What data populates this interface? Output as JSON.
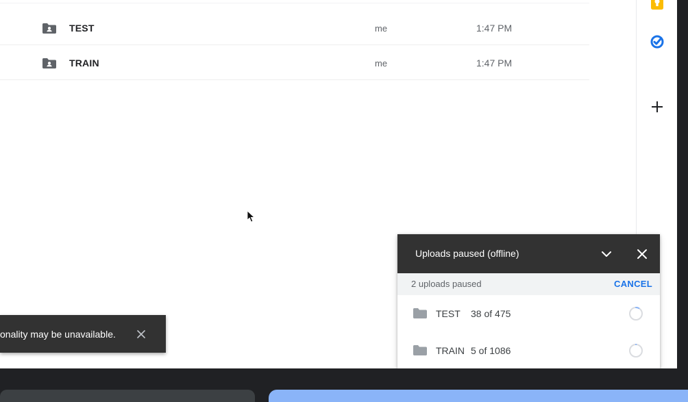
{
  "files": {
    "rows": [
      {
        "name": "TEST",
        "owner": "me",
        "modified": "1:47 PM",
        "icon": "shared-folder-icon"
      },
      {
        "name": "TRAIN",
        "owner": "me",
        "modified": "1:47 PM",
        "icon": "shared-folder-icon"
      }
    ]
  },
  "right_rail": {
    "items": [
      {
        "icon": "keep-icon"
      },
      {
        "icon": "tasks-icon"
      },
      {
        "icon": "add-icon"
      }
    ]
  },
  "toast": {
    "message": "onality may be unavailable.",
    "close_icon": "close-icon"
  },
  "upload_panel": {
    "title": "Uploads paused (offline)",
    "collapse_icon": "chevron-down-icon",
    "close_icon": "close-icon",
    "status": "2 uploads paused",
    "cancel_label": "CANCEL",
    "items": [
      {
        "name": "TEST",
        "progress_text": "38 of 475",
        "completed": 38,
        "total": 475
      },
      {
        "name": "TRAIN",
        "progress_text": "5 of 1086",
        "completed": 5,
        "total": 1086
      }
    ]
  },
  "colors": {
    "dark_panel": "#323232",
    "link_blue": "#1a73e8",
    "keep_yellow": "#fbbc04",
    "tasks_blue": "#1a73e8",
    "folder_gray": "#5f6368",
    "upload_folder_gray": "#9aa0a6"
  }
}
